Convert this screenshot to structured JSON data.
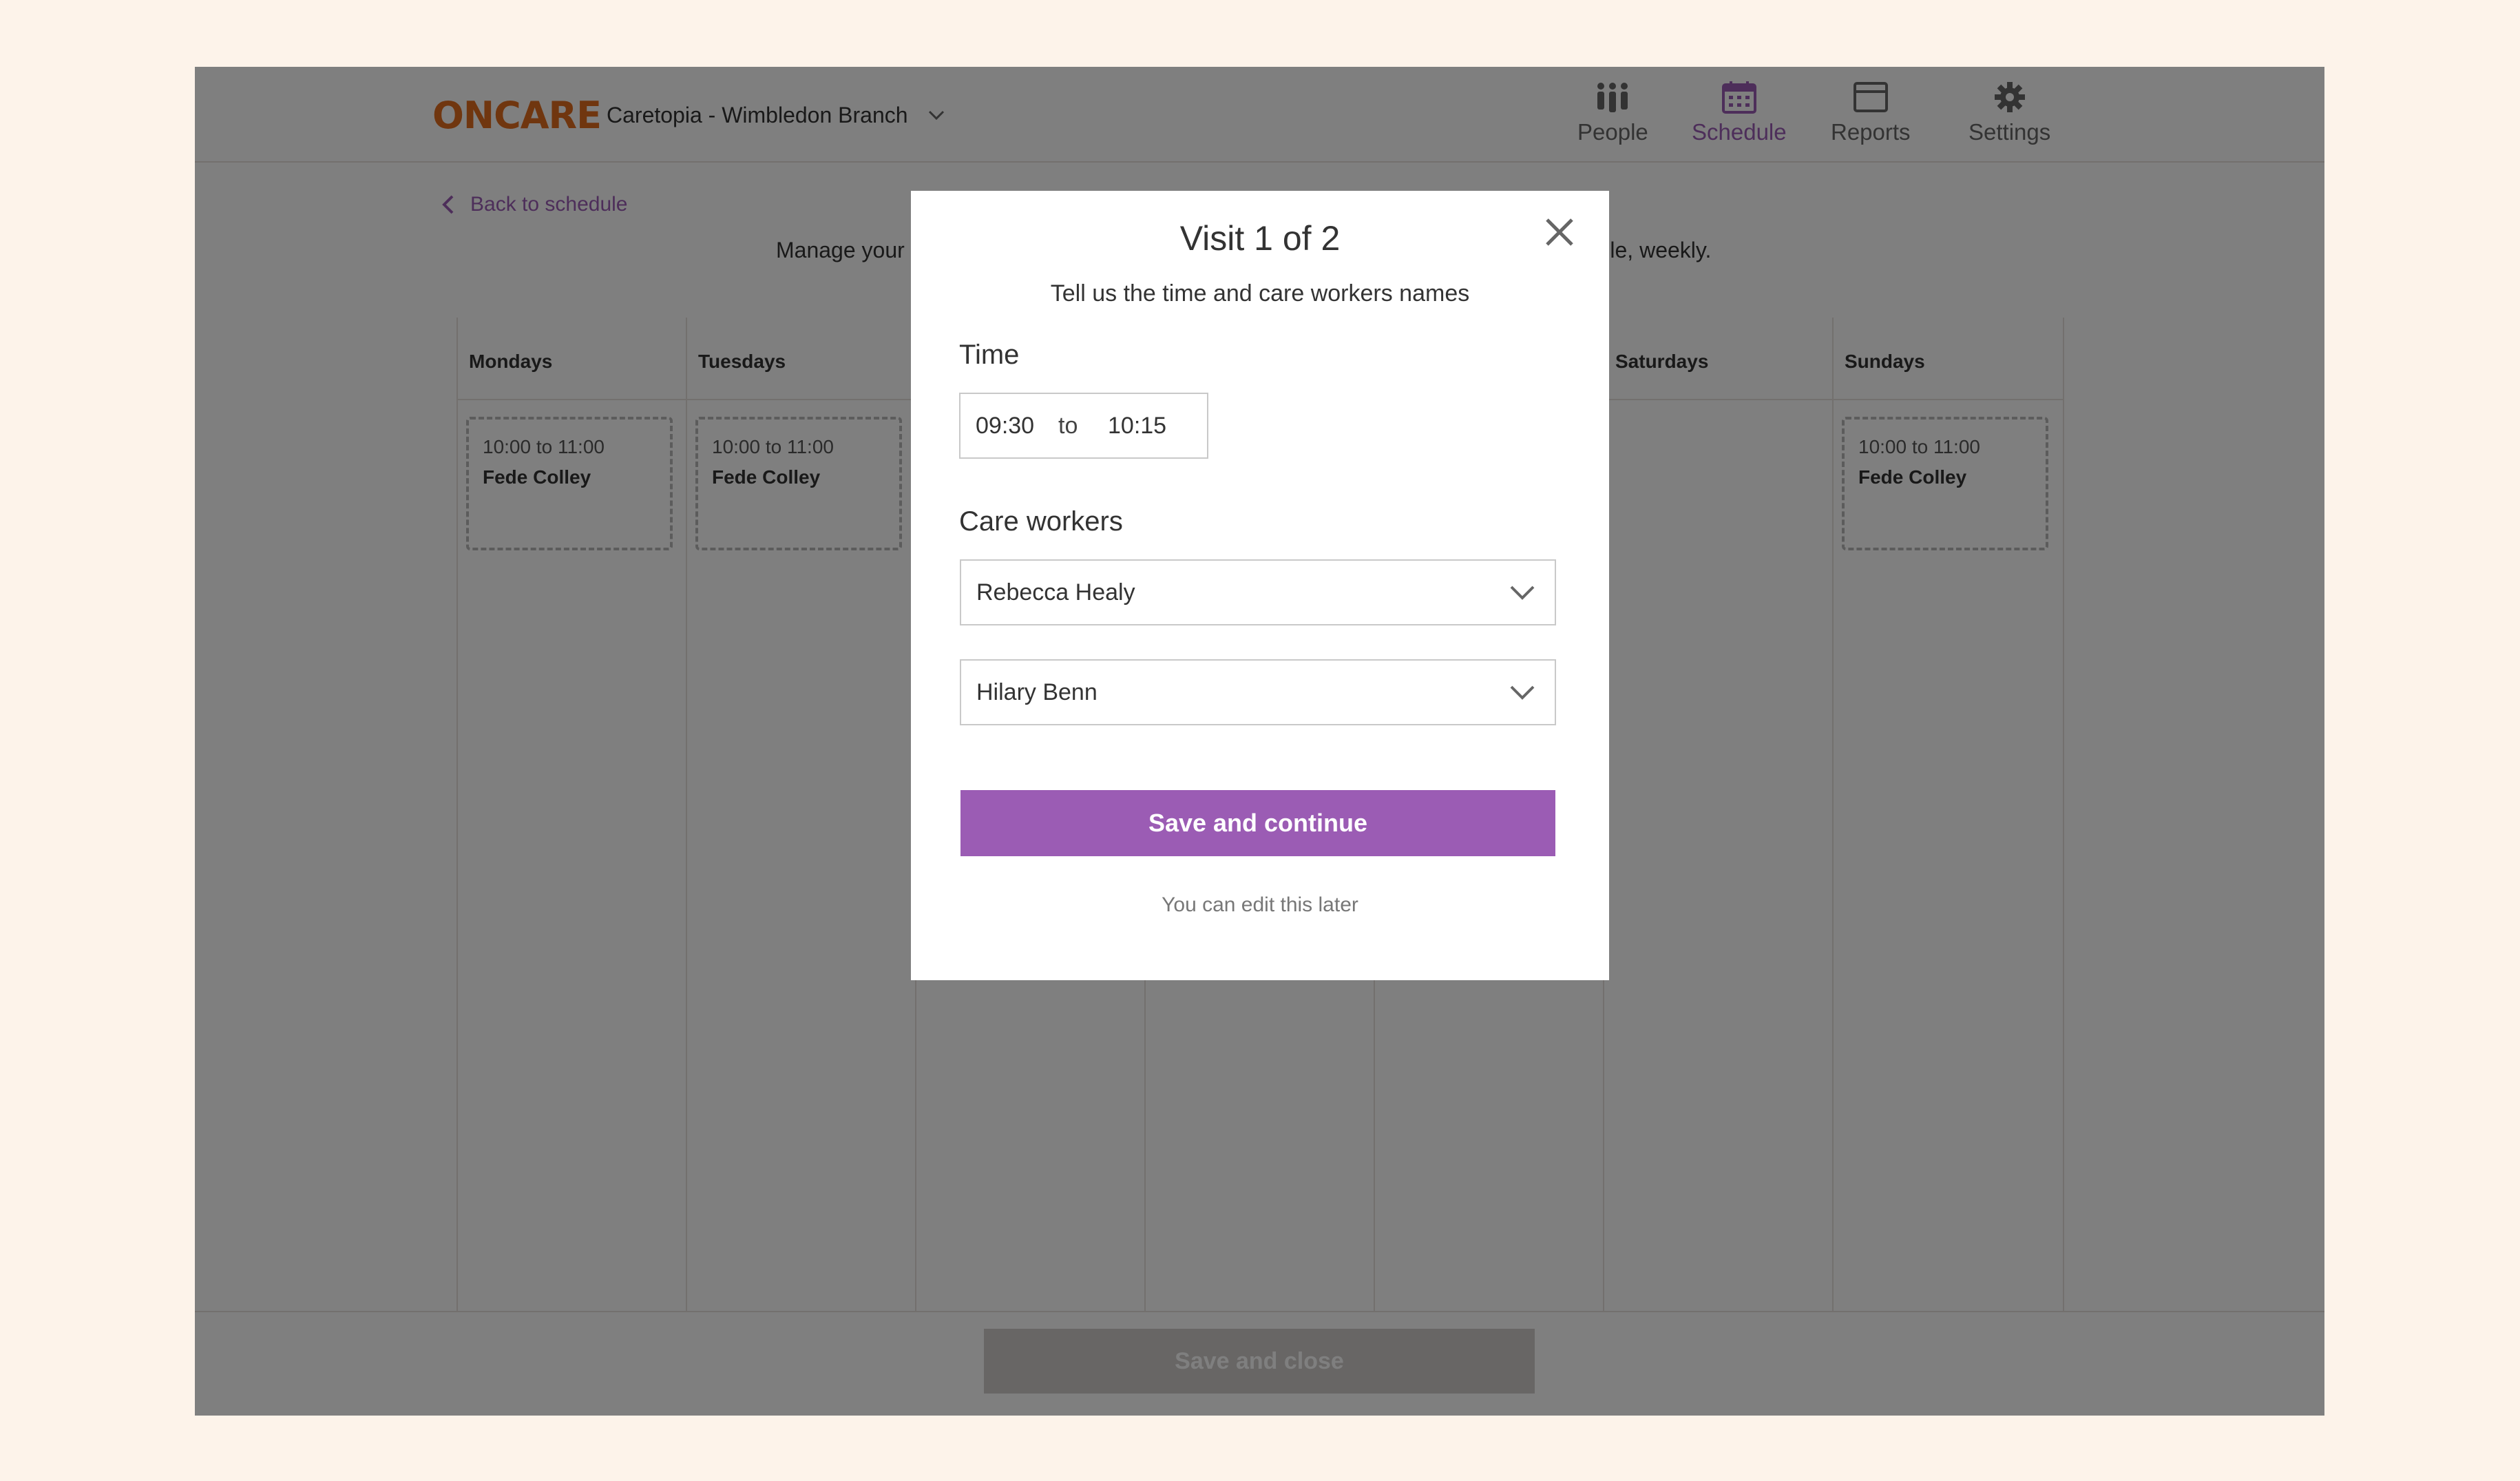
{
  "header": {
    "logo_text": "ONCARE",
    "branch": "Caretopia - Wimbledon Branch",
    "nav": [
      {
        "label": "People",
        "icon": "people-icon",
        "active": false
      },
      {
        "label": "Schedule",
        "icon": "calendar-icon",
        "active": true
      },
      {
        "label": "Reports",
        "icon": "reports-icon",
        "active": false
      },
      {
        "label": "Settings",
        "icon": "gear-icon",
        "active": false
      }
    ]
  },
  "page": {
    "back_label": "Back to schedule",
    "intro_left": "Manage your",
    "intro_right": "edule, weekly.",
    "days": [
      "Mondays",
      "Tuesdays",
      "",
      "",
      "",
      "Saturdays",
      "Sundays"
    ],
    "visits": [
      {
        "day": "Mondays",
        "time": "10:00 to 11:00",
        "worker": "Fede Colley"
      },
      {
        "day": "Tuesdays",
        "time": "10:00 to 11:00",
        "worker": "Fede Colley"
      },
      {
        "day": "Sundays",
        "time": "10:00 to 11:00",
        "worker": "Fede Colley"
      }
    ],
    "save_close_label": "Save and close"
  },
  "modal": {
    "title": "Visit 1 of 2",
    "subtitle": "Tell us the time and care workers names",
    "time_label": "Time",
    "time_from": "09:30",
    "time_to_word": "to",
    "time_to": "10:15",
    "workers_label": "Care workers",
    "worker_1": "Rebecca Healy",
    "worker_2": "Hilary Benn",
    "primary_label": "Save and continue",
    "note": "You can edit this later"
  },
  "colors": {
    "accent": "#9b5cb4",
    "logo": "#e06c1f",
    "page_bg": "#fdf3ea"
  }
}
